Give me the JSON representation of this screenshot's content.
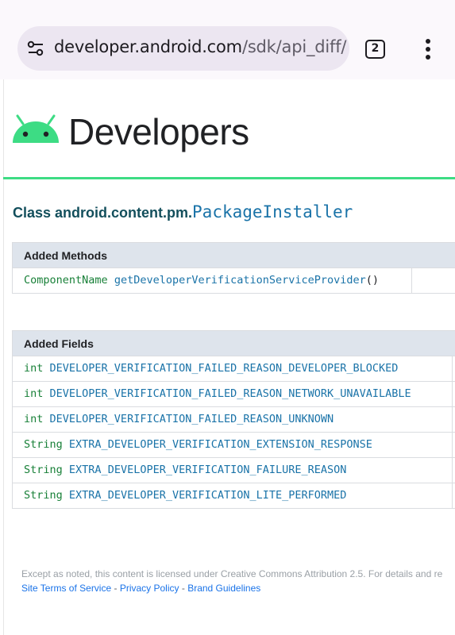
{
  "browser": {
    "url_host": "developer.android.com",
    "url_path": "/sdk/api_diff/",
    "tab_count": "2",
    "site_settings_icon": "tune-icon",
    "menu_icon": "more-vert-icon"
  },
  "header": {
    "logo_icon": "android-icon",
    "brand": "Developers"
  },
  "class_heading": {
    "prefix": "Class android.content.pm.",
    "name": "PackageInstaller"
  },
  "added_methods": {
    "title": "Added Methods",
    "rows": [
      {
        "type": "ComponentName",
        "name": "getDeveloperVerificationServiceProvider",
        "suffix": "()"
      }
    ]
  },
  "added_fields": {
    "title": "Added Fields",
    "rows": [
      {
        "type": "int",
        "name": "DEVELOPER_VERIFICATION_FAILED_REASON_DEVELOPER_BLOCKED"
      },
      {
        "type": "int",
        "name": "DEVELOPER_VERIFICATION_FAILED_REASON_NETWORK_UNAVAILABLE"
      },
      {
        "type": "int",
        "name": "DEVELOPER_VERIFICATION_FAILED_REASON_UNKNOWN"
      },
      {
        "type": "String",
        "name": "EXTRA_DEVELOPER_VERIFICATION_EXTENSION_RESPONSE"
      },
      {
        "type": "String",
        "name": "EXTRA_DEVELOPER_VERIFICATION_FAILURE_REASON"
      },
      {
        "type": "String",
        "name": "EXTRA_DEVELOPER_VERIFICATION_LITE_PERFORMED"
      }
    ]
  },
  "footer": {
    "notice": "Except as noted, this content is licensed under Creative Commons Attribution 2.5. For details and re",
    "links": [
      "Site Terms of Service",
      "Privacy Policy",
      "Brand Guidelines"
    ],
    "separator": " - "
  },
  "colors": {
    "accent_green": "#3ddc84",
    "link_blue": "#1a73a8",
    "type_green": "#188038",
    "heading_teal": "#134f5c"
  }
}
